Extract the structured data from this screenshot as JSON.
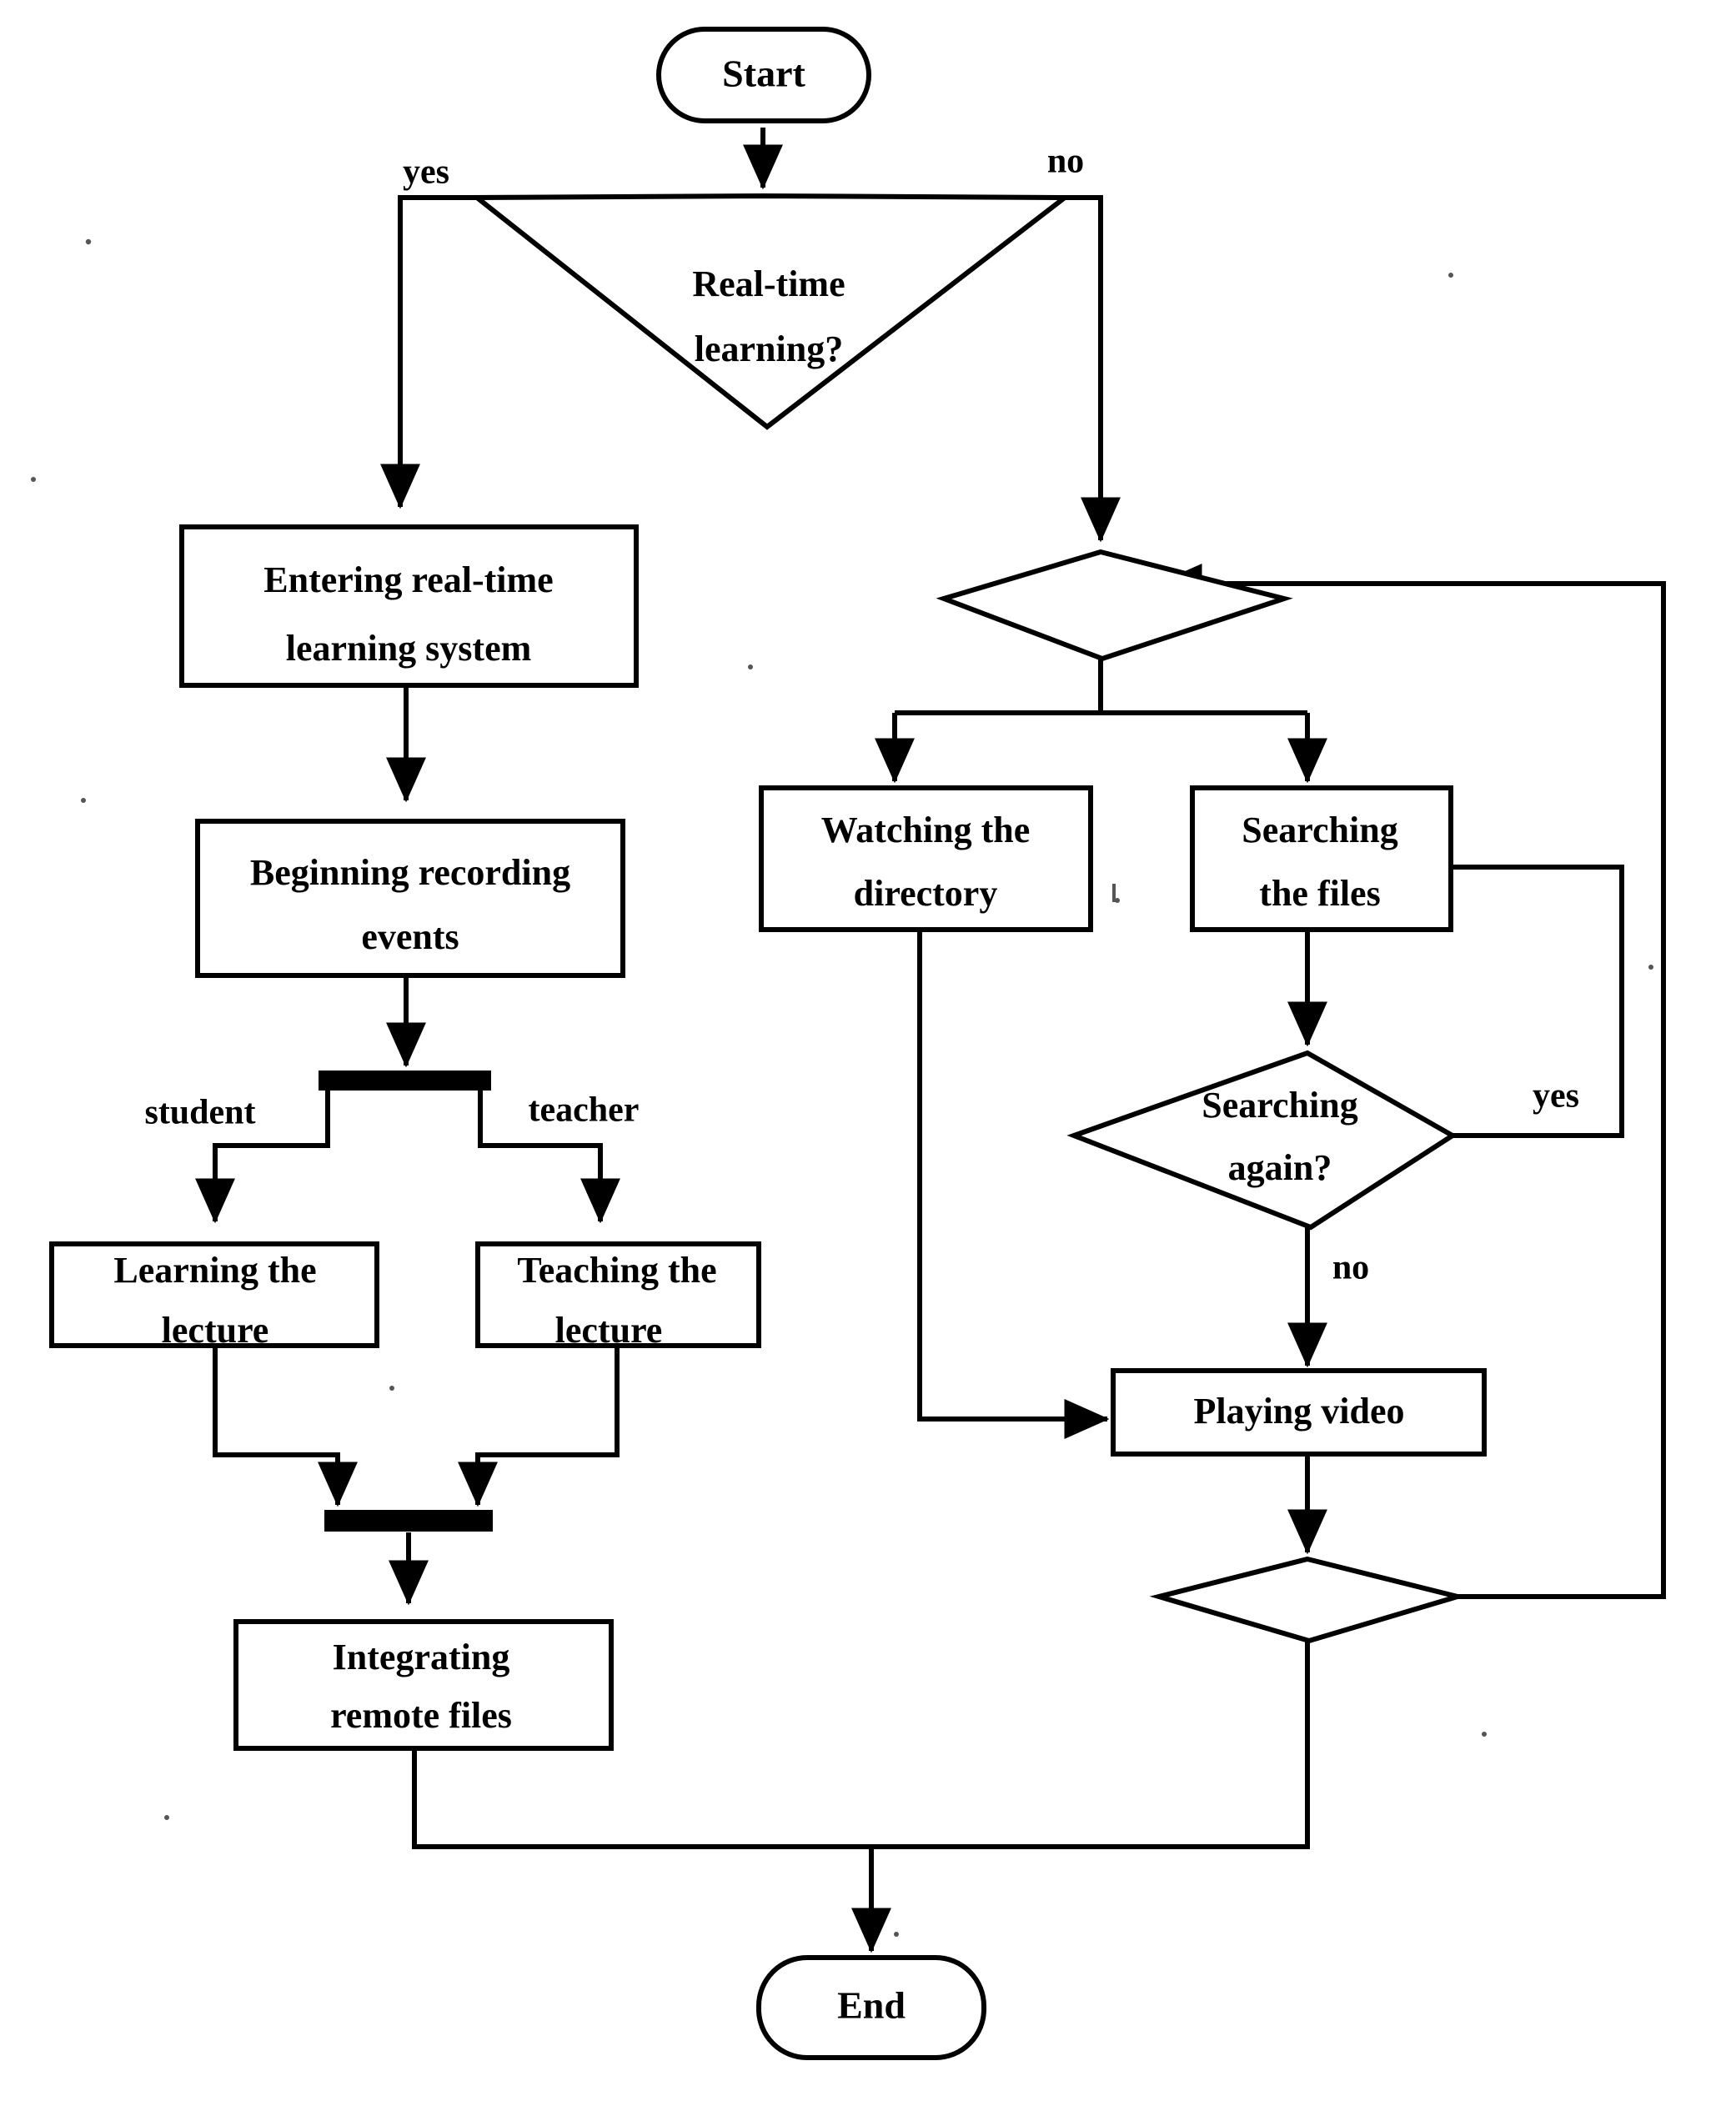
{
  "diagram": {
    "title": "Real-time learning and video playback flowchart",
    "type": "flowchart",
    "ink_color": "#000000",
    "background_color": "#ffffff"
  },
  "nodes": {
    "start": {
      "label": "Start",
      "shape": "terminator"
    },
    "decision_realtime": {
      "label_line1": "Real-time",
      "label_line2": "learning?",
      "shape": "decision"
    },
    "entering_system": {
      "label_line1": "Entering real-time",
      "label_line2": "learning system",
      "shape": "process"
    },
    "beginning_recording": {
      "label_line1": "Beginning recording",
      "label_line2": "events",
      "shape": "process"
    },
    "fork_bar": {
      "label": "",
      "shape": "fork-bar"
    },
    "learning_lecture": {
      "label_line1": "Learning the",
      "label_line2": "lecture",
      "shape": "process"
    },
    "teaching_lecture": {
      "label_line1": "Teaching the",
      "label_line2": "lecture",
      "shape": "process"
    },
    "join_bar": {
      "label": "",
      "shape": "join-bar"
    },
    "integrating_files": {
      "label_line1": "Integrating",
      "label_line2": "remote files",
      "shape": "process"
    },
    "decision_browse": {
      "label": "",
      "shape": "decision"
    },
    "watching_directory": {
      "label_line1": "Watching the",
      "label_line2": "directory",
      "shape": "process"
    },
    "searching_files": {
      "label_line1": "Searching",
      "label_line2": "the files",
      "shape": "process"
    },
    "decision_search_again": {
      "label_line1": "Searching",
      "label_line2": "again?",
      "shape": "decision"
    },
    "playing_video": {
      "label": "Playing video",
      "shape": "process"
    },
    "decision_loop": {
      "label": "",
      "shape": "decision"
    },
    "end": {
      "label": "End",
      "shape": "terminator"
    }
  },
  "edge_labels": {
    "realtime_yes": "yes",
    "realtime_no": "no",
    "fork_student": "student",
    "fork_teacher": "teacher",
    "search_again_yes": "yes",
    "search_again_no": "no"
  }
}
